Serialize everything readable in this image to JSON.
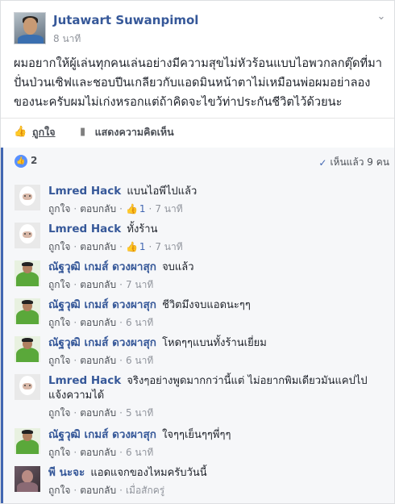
{
  "post": {
    "author": "Jutawart Suwanpimol",
    "time": "8 นาที",
    "menu_icon": "chevron-down-icon",
    "text": "ผมอยากให้ผู้เล่นทุกคนเล่นอย่างมีความสุขไม่หัวร้อนแบบไอพวกลกตุ๊ดที่มาปั่นป่วนเซิฟและชอบปีนเกลียวกับแอดมินหน้าตาไม่เหมือนพ่อผมอย่าลองของนะครับผมไม่เก่งหรอกแต่ถ้าคิดจะไขว้ท่าประกันชีวิตไว้ด้วยนะ",
    "actions": {
      "like_label": "ถูกใจ",
      "comment_label": "แสดงความคิดเห็น"
    }
  },
  "reactions": {
    "count": "2",
    "seen_label": "เห็นแล้ว 9 คน"
  },
  "comments": [
    {
      "name": "Lmred Hack",
      "text": "แบนไอพีไปแล้ว",
      "like": "ถูกใจ",
      "reply": "ตอบกลับ",
      "likes": "1",
      "time": "7 นาที",
      "avatar": "white"
    },
    {
      "name": "Lmred Hack",
      "text": "ทั้งร้าน",
      "like": "ถูกใจ",
      "reply": "ตอบกลับ",
      "likes": "1",
      "time": "7 นาที",
      "avatar": "white"
    },
    {
      "name": "ณัฐวุฒิ เกมส์ ดวงผาสุก",
      "text": "จบแล้ว",
      "like": "ถูกใจ",
      "reply": "ตอบกลับ",
      "likes": "",
      "time": "7 นาที",
      "avatar": "green"
    },
    {
      "name": "ณัฐวุฒิ เกมส์ ดวงผาสุก",
      "text": "ชีวิตมึงจบแอดนะๆๆ",
      "like": "ถูกใจ",
      "reply": "ตอบกลับ",
      "likes": "",
      "time": "6 นาที",
      "avatar": "green"
    },
    {
      "name": "ณัฐวุฒิ เกมส์ ดวงผาสุก",
      "text": "โหดๆๆแบนทั้งร้านเยี่ยม",
      "like": "ถูกใจ",
      "reply": "ตอบกลับ",
      "likes": "",
      "time": "6 นาที",
      "avatar": "green"
    },
    {
      "name": "Lmred Hack",
      "text": "จริงๆอย่างพูดมากกว่านี้แต่ ไม่อยากพิมเดียวมันแคปไป แจ้งความได้",
      "like": "ถูกใจ",
      "reply": "ตอบกลับ",
      "likes": "",
      "time": "5 นาที",
      "avatar": "white"
    },
    {
      "name": "ณัฐวุฒิ เกมส์ ดวงผาสุก",
      "text": "ใจๆๆเย็นๆๆพี่ๆๆ",
      "like": "ถูกใจ",
      "reply": "ตอบกลับ",
      "likes": "",
      "time": "6 นาที",
      "avatar": "green"
    },
    {
      "name": "พี นะจะ",
      "text": "แอดแจกของไหมครับวันนี้",
      "like": "ถูกใจ",
      "reply": "ตอบกลับ",
      "likes": "",
      "time": "เมื่อสักครู่",
      "avatar": "dark"
    }
  ]
}
